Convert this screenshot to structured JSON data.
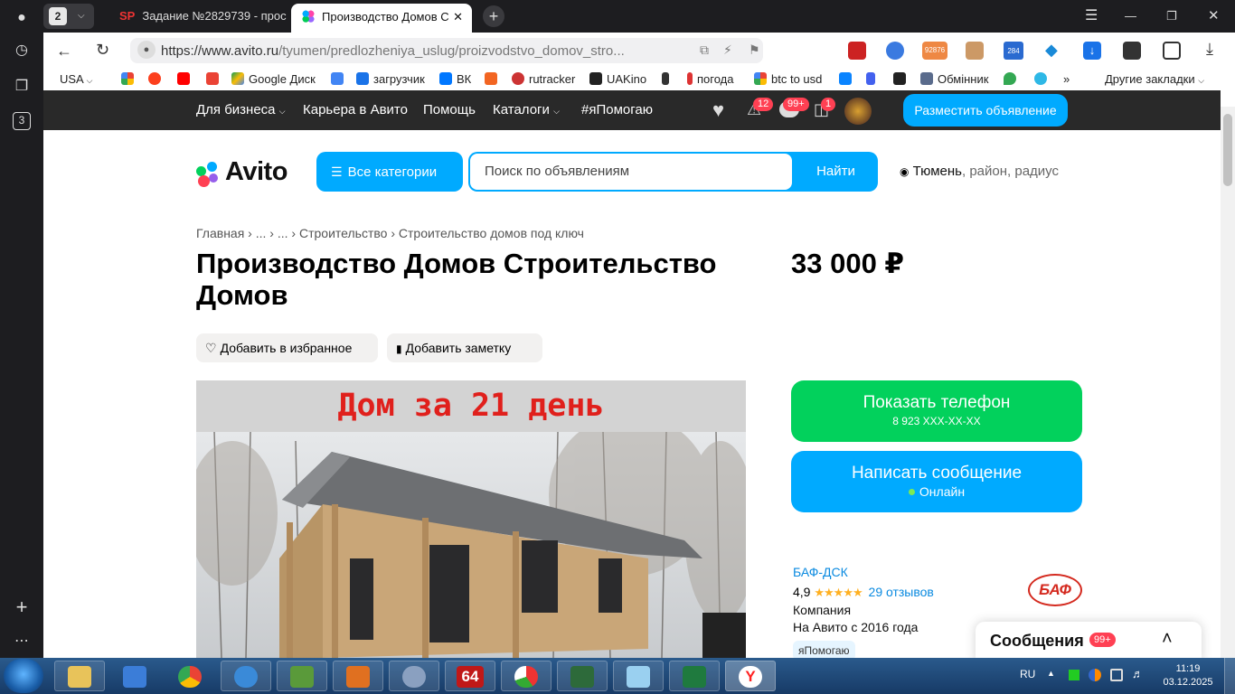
{
  "tabs": {
    "count": "2",
    "tab1_label": "Задание №2829739 - прос",
    "tab2_label": "Производство Домов С"
  },
  "address": {
    "host": "https://www.avito.ru",
    "path": "/tyumen/predlozheniya_uslug/proizvodstvo_domov_stro..."
  },
  "toolbar_badges": {
    "ext1": "92876",
    "ext2": "284"
  },
  "bookmarks": [
    "USA",
    "Google Диск",
    "загрузчик",
    "ВК",
    "rutracker",
    "UAKino",
    "погода",
    "btc to usd",
    "Обмінник",
    "Другие закладки"
  ],
  "side": {
    "tab_count": "3"
  },
  "avito_nav": {
    "business": "Для бизнеса",
    "career": "Карьера в Авито",
    "help": "Помощь",
    "catalogs": "Каталоги",
    "ya_help": "#яПомогаю",
    "notif_badge": "12",
    "msg_badge": "99+",
    "cart_badge": "1",
    "post_button": "Разместить объявление"
  },
  "header": {
    "logo_text": "Avito",
    "categories_button": "Все категории",
    "search_placeholder": "Поиск по объявлениям",
    "search_button": "Найти",
    "location_city": "Тюмень",
    "location_rest": ", район, радиус"
  },
  "breadcrumbs": [
    "Главная",
    "...",
    "...",
    "Строительство",
    "Строительство домов под ключ"
  ],
  "listing": {
    "title": "Производство Домов Строительство Домов",
    "price": "33 000 ₽",
    "favorite_button": "Добавить в избранное",
    "note_button": "Добавить заметку",
    "image_caption": "Дом за 21 день"
  },
  "actions": {
    "show_phone": "Показать телефон",
    "phone_mask": "8 923 XXX-XX-XX",
    "write_message": "Написать сообщение",
    "online": "Онлайн"
  },
  "seller": {
    "name": "БАФ-ДСК",
    "rating": "4,9",
    "reviews": "29 отзывов",
    "type": "Компания",
    "since": "На Авито с 2016 года",
    "badge": "яПомогаю",
    "logo_text": "БАФ"
  },
  "messages_panel": {
    "label": "Сообщения",
    "badge": "99+"
  },
  "tray": {
    "lang": "RU",
    "time": "11:19",
    "date": "03.12.2025",
    "badge64": "64"
  },
  "colors": {
    "accent_blue": "#00AAFF",
    "green": "#02D15C",
    "nav_dark": "#292929",
    "badge_red": "#FF4053"
  }
}
